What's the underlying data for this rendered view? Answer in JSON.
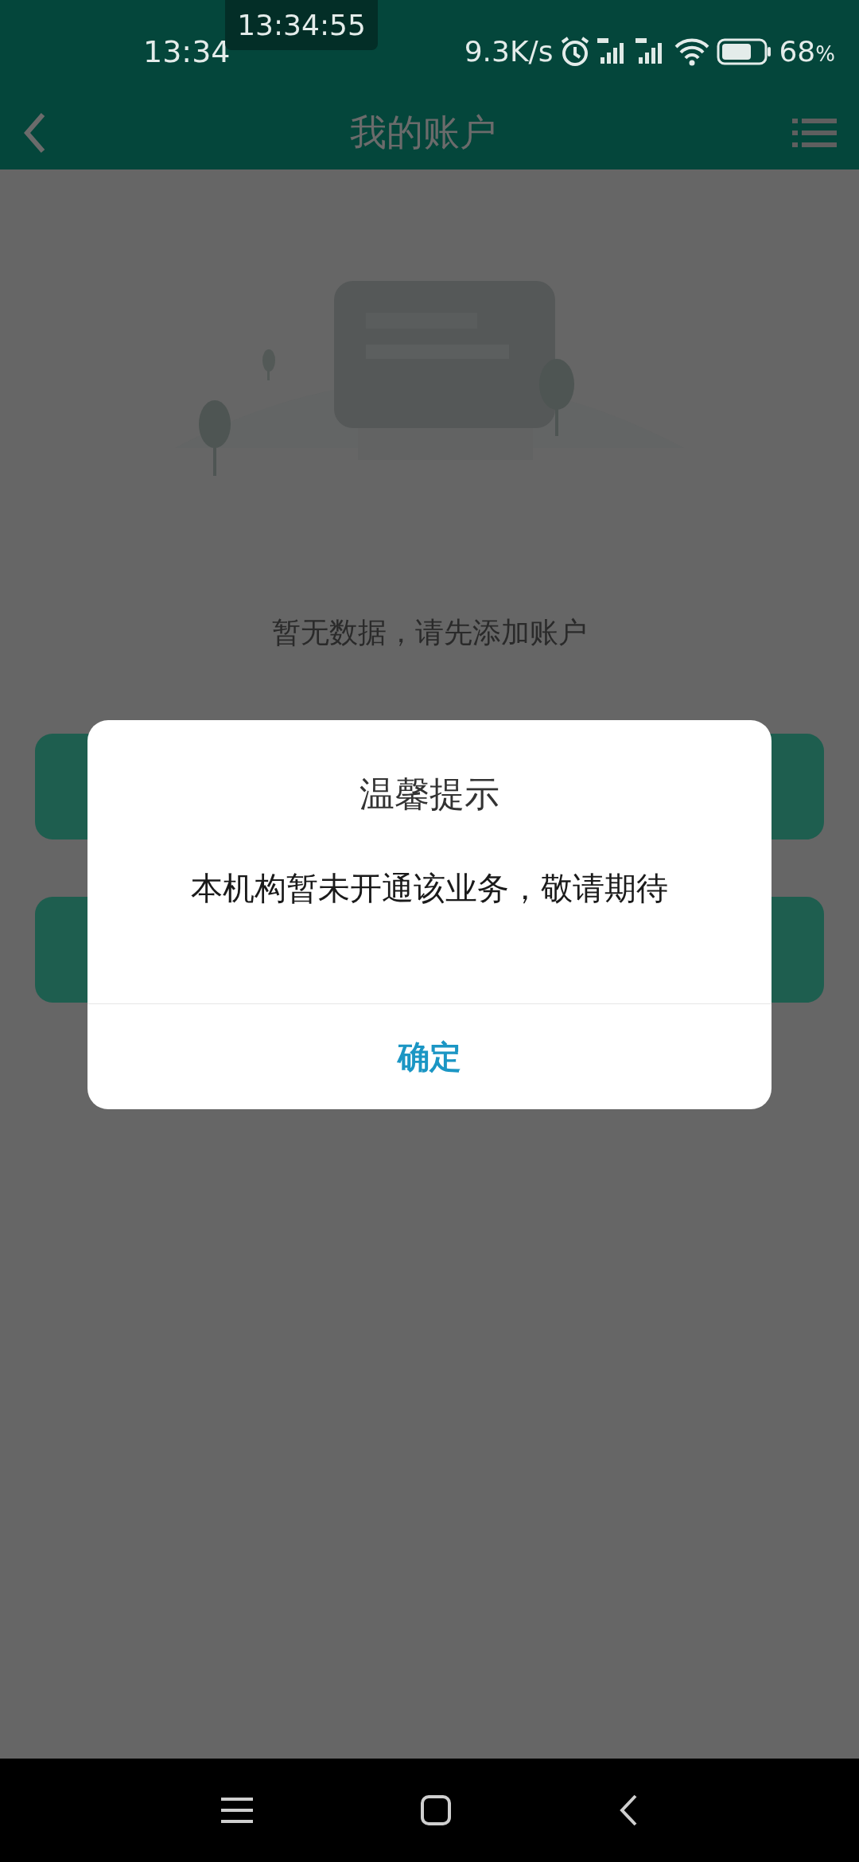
{
  "status_bar": {
    "time": "13:34",
    "notification_time": "13:34:55",
    "net_speed": "9.3K/s",
    "battery": "68",
    "battery_unit": "%"
  },
  "header": {
    "title": "我的账户"
  },
  "empty_state": {
    "message": "暂无数据，请先添加账户"
  },
  "dialog": {
    "title": "温馨提示",
    "message": "本机构暂未开通该业务，敬请期待",
    "confirm": "确定"
  }
}
